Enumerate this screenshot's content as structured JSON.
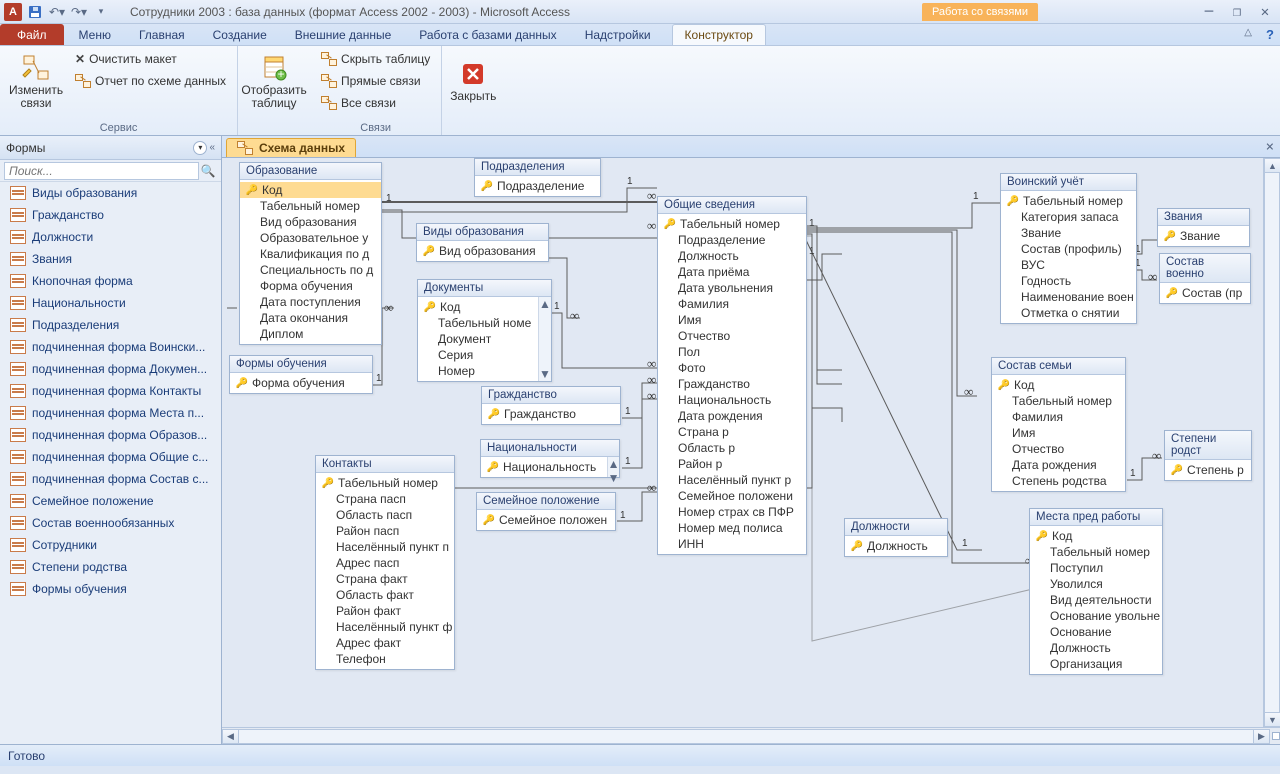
{
  "titlebar": {
    "title": "Сотрудники 2003 : база данных (формат Access 2002 - 2003)  -  Microsoft Access",
    "context_label": "Работа со связями"
  },
  "tabs": {
    "file": "Файл",
    "items": [
      "Меню",
      "Главная",
      "Создание",
      "Внешние данные",
      "Работа с базами данных",
      "Надстройки"
    ],
    "context": "Конструктор"
  },
  "ribbon": {
    "g1": {
      "label": "Сервис",
      "edit_rel": "Изменить связи",
      "clear": "Очистить макет",
      "report": "Отчет по схеме данных"
    },
    "g2": {
      "show_table": "Отобразить таблицу"
    },
    "g3": {
      "label": "Связи",
      "hide": "Скрыть таблицу",
      "direct": "Прямые связи",
      "all": "Все связи"
    },
    "g4": {
      "close": "Закрыть"
    }
  },
  "nav": {
    "header": "Формы",
    "search_placeholder": "Поиск...",
    "items": [
      "Виды образования",
      "Гражданство",
      "Должности",
      "Звания",
      "Кнопочная форма",
      "Национальности",
      "Подразделения",
      "подчиненная форма Воински...",
      "подчиненная форма Докумен...",
      "подчиненная форма Контакты",
      "подчиненная форма Места п...",
      "подчиненная форма Образов...",
      "подчиненная форма Общие с...",
      "подчиненная форма Состав с...",
      "Семейное положение",
      "Состав военнообязанных",
      "Сотрудники",
      "Степени родства",
      "Формы обучения"
    ]
  },
  "doctab": "Схема данных",
  "tables": {
    "edu": {
      "title": "Образование",
      "fields": [
        "Код",
        "Табельный номер",
        "Вид образования",
        "Образовательное у",
        "Квалификация по д",
        "Специальность по д",
        "Форма обучения",
        "Дата поступления",
        "Дата окончания",
        "Диплом"
      ]
    },
    "dept": {
      "title": "Подразделения",
      "fields": [
        "Подразделение"
      ]
    },
    "edutype": {
      "title": "Виды образования",
      "fields": [
        "Вид образования"
      ]
    },
    "eduform": {
      "title": "Формы обучения",
      "fields": [
        "Форма обучения"
      ]
    },
    "docs": {
      "title": "Документы",
      "fields": [
        "Код",
        "Табельный номе",
        "Документ",
        "Серия",
        "Номер"
      ]
    },
    "cit": {
      "title": "Гражданство",
      "fields": [
        "Гражданство"
      ]
    },
    "nat": {
      "title": "Национальности",
      "fields": [
        "Национальность"
      ]
    },
    "fam": {
      "title": "Семейное положение",
      "fields": [
        "Семейное положен"
      ]
    },
    "cont": {
      "title": "Контакты",
      "fields": [
        "Табельный номер",
        "Страна пасп",
        "Область пасп",
        "Район пасп",
        "Населённый пункт п",
        "Адрес пасп",
        "Страна факт",
        "Область факт",
        "Район факт",
        "Населённый пункт ф",
        "Адрес факт",
        "Телефон"
      ]
    },
    "gen": {
      "title": "Общие сведения",
      "fields": [
        "Табельный номер",
        "Подразделение",
        "Должность",
        "Дата приёма",
        "Дата увольнения",
        "Фамилия",
        "Имя",
        "Отчество",
        "Пол",
        "Фото",
        "Гражданство",
        "Национальность",
        "Дата рождения",
        "Страна р",
        "Область р",
        "Район р",
        "Населённый пункт р",
        "Семейное положени",
        "Номер страх св ПФР",
        "Номер мед полиса",
        "ИНН"
      ]
    },
    "pos": {
      "title": "Должности",
      "fields": [
        "Должность"
      ]
    },
    "mil": {
      "title": "Воинский учёт",
      "fields": [
        "Табельный номер",
        "Категория запаса",
        "Звание",
        "Состав (профиль)",
        "ВУС",
        "Годность",
        "Наименование воен",
        "Отметка о снятии"
      ]
    },
    "rank": {
      "title": "Звания",
      "fields": [
        "Звание"
      ]
    },
    "milcomp": {
      "title": "Состав военно",
      "fields": [
        "Состав (пр"
      ]
    },
    "family": {
      "title": "Состав семьи",
      "fields": [
        "Код",
        "Табельный номер",
        "Фамилия",
        "Имя",
        "Отчество",
        "Дата рождения",
        "Степень родства"
      ]
    },
    "kin": {
      "title": "Степени родст",
      "fields": [
        "Степень р"
      ]
    },
    "prev": {
      "title": "Места пред работы",
      "fields": [
        "Код",
        "Табельный номер",
        "Поступил",
        "Уволился",
        "Вид деятельности",
        "Основание увольне",
        "Основание",
        "Должность",
        "Организация"
      ]
    }
  },
  "status": "Готово"
}
